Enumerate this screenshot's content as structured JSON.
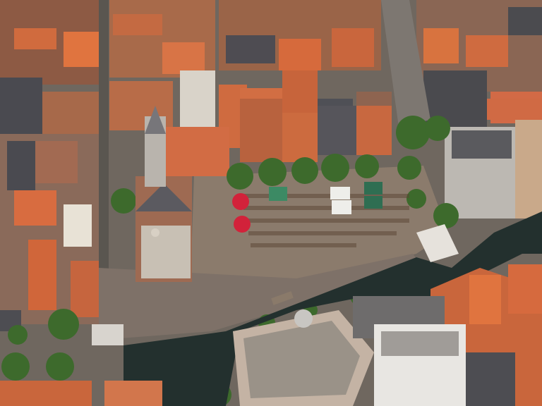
{
  "scene": {
    "kind": "aerial-photograph",
    "subject": "dutch-canal-town-square",
    "colors": {
      "roof_orange": "#c8643a",
      "roof_dark": "#4a4a4e",
      "square_paving": "#8a7a6c",
      "canal_water": "#23302e",
      "tree_green": "#3f6b2c",
      "umbrella_red": "#d2223a",
      "umbrella_white": "#eeeeea",
      "tent_green": "#3c8a64",
      "street": "#7b7670"
    }
  }
}
